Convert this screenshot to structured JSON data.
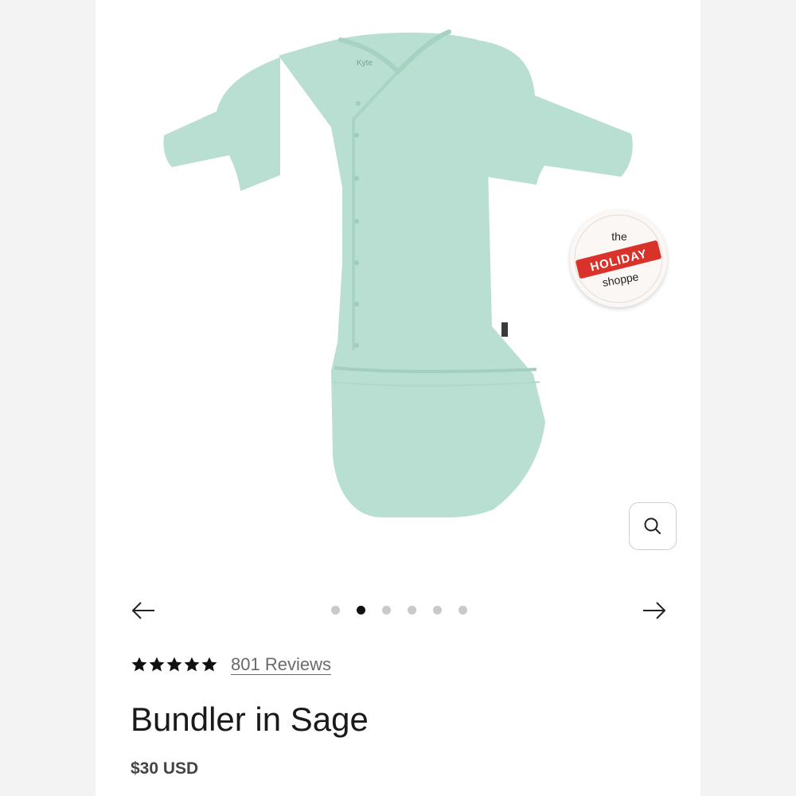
{
  "product": {
    "brand_tag": "Kyte",
    "badge": {
      "top": "the",
      "ribbon": "HOLIDAY",
      "bottom": "shoppe"
    },
    "rating_stars": 5,
    "reviews_label": "801 Reviews",
    "title": "Bundler in Sage",
    "price": "$30 USD"
  },
  "gallery": {
    "image_count": 6,
    "active_index": 1,
    "garment_color": "#b8dfd1",
    "zoom_icon": "search-icon",
    "prev_icon": "arrow-left-icon",
    "next_icon": "arrow-right-icon"
  },
  "colors": {
    "ribbon": "#d8322b",
    "text": "#1a1a1a",
    "muted": "#6a6a6a"
  }
}
